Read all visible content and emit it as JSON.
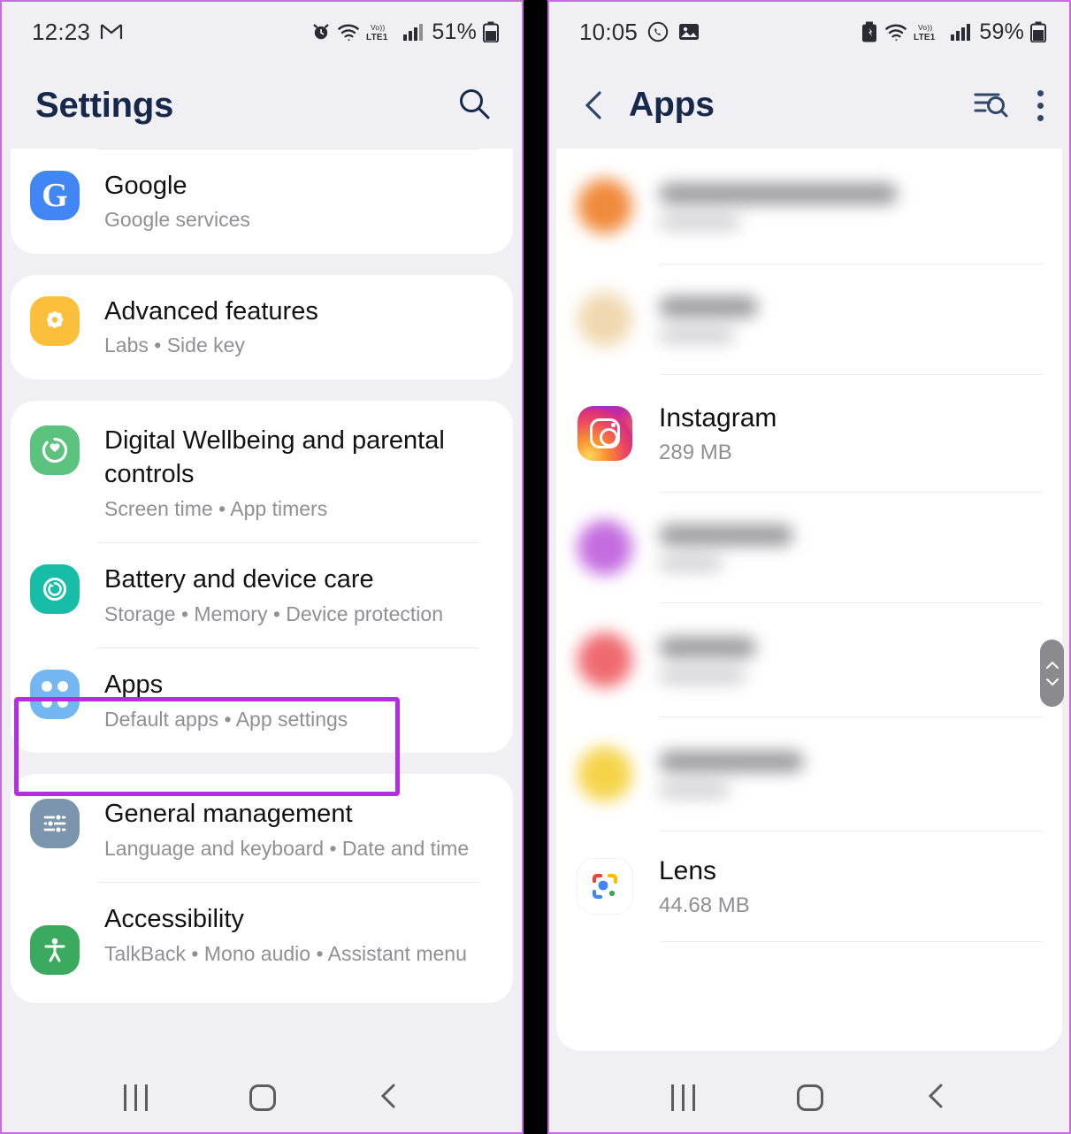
{
  "theme": {
    "accent_purple": "#b62ce0",
    "panel_border": "#c96ae8",
    "bg": "#f0eff4",
    "card": "#ffffff",
    "title_navy": "#17294b",
    "subtitle_gray": "#8f8f94"
  },
  "left_phone": {
    "status_bar": {
      "clock": "12:23",
      "left_icons": [
        "gmail-icon"
      ],
      "right_icons": [
        "alarm-icon",
        "wifi-icon",
        "volte-lte1-icon",
        "signal-bars-icon"
      ],
      "battery_percent": "51%"
    },
    "header": {
      "title": "Settings",
      "search_icon": "search-icon"
    },
    "groups": [
      {
        "items": [
          {
            "icon": "google-icon",
            "title": "Google",
            "subtitle": "Google services"
          }
        ]
      },
      {
        "items": [
          {
            "icon": "advanced-features-icon",
            "title": "Advanced features",
            "subtitle": "Labs  •  Side key"
          }
        ]
      },
      {
        "items": [
          {
            "icon": "digital-wellbeing-icon",
            "title": "Digital Wellbeing and parental controls",
            "subtitle": "Screen time  •  App timers"
          },
          {
            "icon": "battery-care-icon",
            "title": "Battery and device care",
            "subtitle": "Storage  •  Memory  •  Device protection"
          },
          {
            "icon": "apps-icon",
            "title": "Apps",
            "subtitle": "Default apps  •  App settings",
            "highlighted": true
          }
        ]
      },
      {
        "items": [
          {
            "icon": "general-management-icon",
            "title": "General management",
            "subtitle": "Language and keyboard  •  Date and time"
          },
          {
            "icon": "accessibility-icon",
            "title": "Accessibility",
            "subtitle": "TalkBack  •  Mono audio  •  Assistant menu"
          }
        ]
      }
    ],
    "nav_bar": {
      "recents": "recents-icon",
      "home": "home-icon",
      "back": "back-icon"
    }
  },
  "right_phone": {
    "status_bar": {
      "clock": "10:05",
      "left_icons": [
        "whatsapp-icon",
        "gallery-icon"
      ],
      "right_icons": [
        "battery-saver-icon",
        "wifi-icon",
        "volte-lte1-icon",
        "signal-bars-icon"
      ],
      "battery_percent": "59%"
    },
    "header": {
      "back_icon": "back-chevron-icon",
      "title": "Apps",
      "sort_search_icon": "sort-search-icon",
      "more_icon": "more-options-icon"
    },
    "app_list": [
      {
        "icon_color": "#f08a3c",
        "name": "",
        "size": "",
        "blurred": true
      },
      {
        "icon_color": "#f0d8b0",
        "name": "",
        "size": "",
        "blurred": true
      },
      {
        "icon": "instagram-icon",
        "name": "Instagram",
        "size": "289 MB",
        "blurred": false,
        "annotated": true
      },
      {
        "icon_color": "#c46ce0",
        "name": "",
        "size": "",
        "blurred": true
      },
      {
        "icon_color": "#ef6a70",
        "name": "",
        "size": "",
        "blurred": true
      },
      {
        "icon_color": "#f5d44a",
        "name": "",
        "size": "",
        "blurred": true
      },
      {
        "icon": "google-lens-icon",
        "name": "Lens",
        "size": "44.68 MB",
        "blurred": false
      }
    ],
    "scrollbar": {
      "name": "scrollbar-thumb",
      "up_icon": "chevron-up-icon",
      "down_icon": "chevron-down-icon"
    },
    "fab": {
      "name": "scroll-to-top-button",
      "icon": "arrow-to-top-icon"
    },
    "nav_bar": {
      "recents": "recents-icon",
      "home": "home-icon",
      "back": "back-icon"
    }
  },
  "annotations": [
    {
      "type": "arrow",
      "color": "#b62ce0",
      "points_at": "Instagram"
    },
    {
      "type": "rectangle",
      "color": "#b62ce0",
      "around": "Apps"
    }
  ]
}
